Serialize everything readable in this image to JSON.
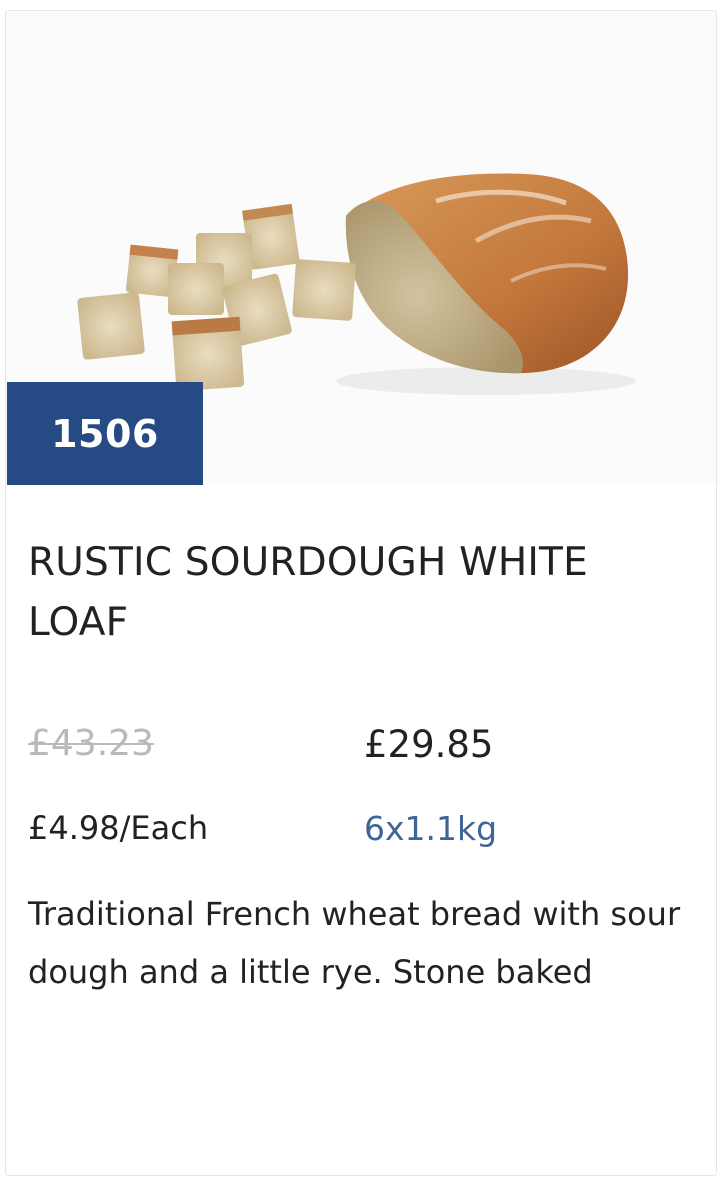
{
  "product": {
    "code": "1506",
    "title": "RUSTIC SOURDOUGH WHITE LOAF",
    "price_old": "£43.23",
    "price_new": "£29.85",
    "unit_price": "£4.98/Each",
    "pack_size": "6x1.1kg",
    "description": "Traditional French wheat bread with sour dough and a little rye. Stone baked",
    "image_subject": "sourdough-loaf-and-bread-cubes"
  },
  "colors": {
    "badge_background": "#254a84",
    "pack_size_text": "#3f6598",
    "old_price_text": "#b9b9b9"
  }
}
